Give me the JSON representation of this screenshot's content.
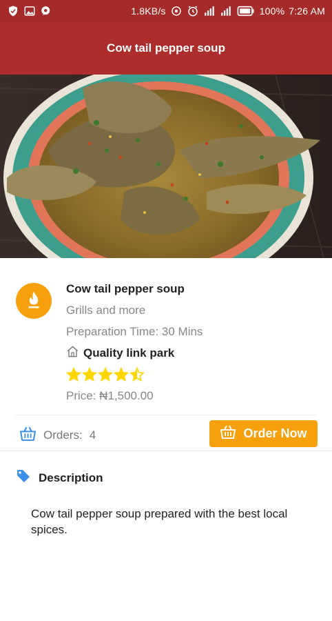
{
  "status_bar": {
    "speed": "1.8KB/s",
    "battery": "100%",
    "time": "7:26 AM"
  },
  "app_bar": {
    "title": "Cow tail pepper soup"
  },
  "hero": {
    "alt": "Cow tail pepper soup"
  },
  "dish": {
    "name": "Cow tail pepper soup",
    "category": "Grills and more",
    "prep_time": "Preparation Time: 30 Mins",
    "location": "Quality link park",
    "rating": 4.5,
    "rating_max": 5,
    "price": "Price: ₦1,500.00"
  },
  "orders": {
    "label": "Orders:",
    "count": "4",
    "button_label": "Order Now"
  },
  "description": {
    "title": "Description",
    "text": "Cow tail pepper soup prepared with the best local spices."
  },
  "colors": {
    "app_bar": "#ad2d2d",
    "status_bar": "#a52a2a",
    "accent": "#f6a10b",
    "star": "#ffd600",
    "icon_blue": "#3b8fe8"
  },
  "icons": {
    "vendor_logo": "flame-icon",
    "location": "home-icon",
    "orders": "basket-icon",
    "description": "tag-icon"
  }
}
